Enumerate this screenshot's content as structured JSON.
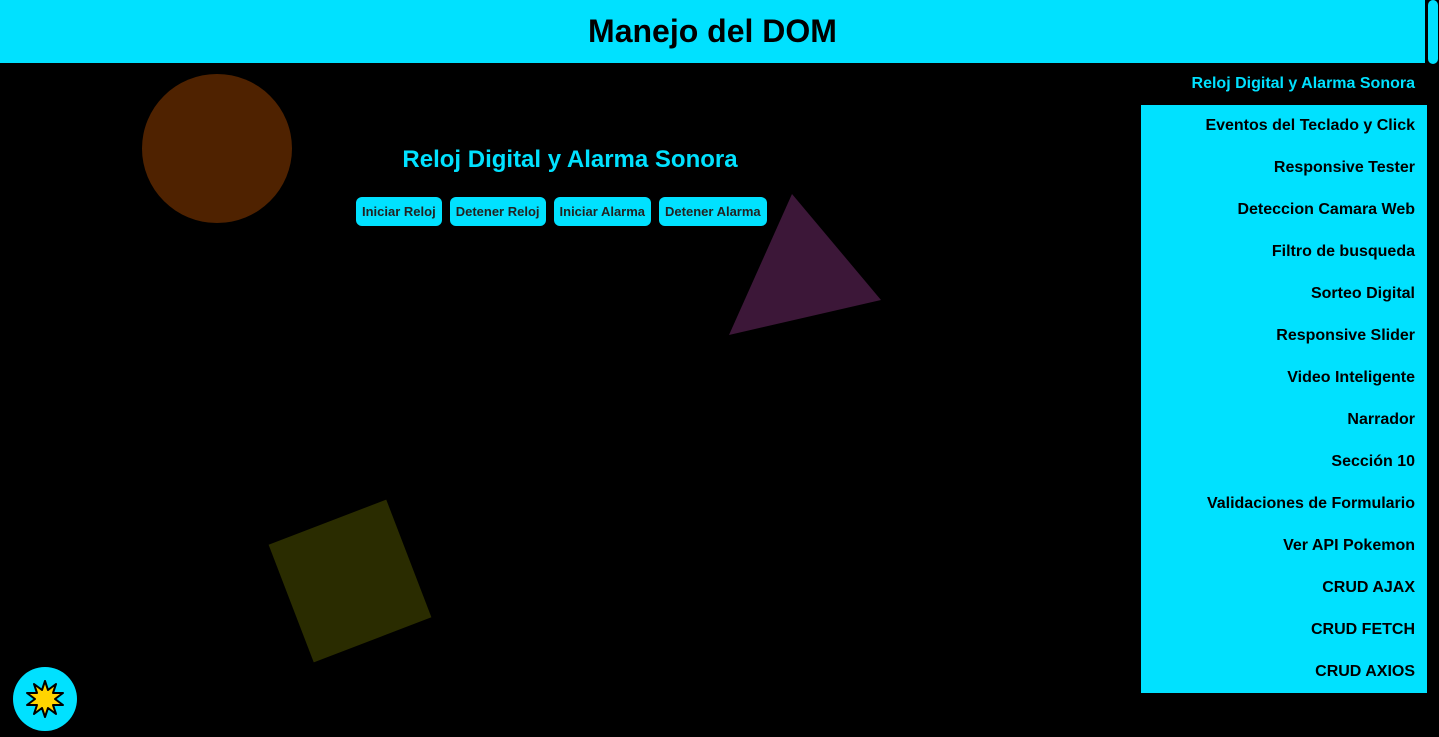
{
  "header": {
    "title": "Manejo del DOM"
  },
  "menu": {
    "items": [
      {
        "label": "Reloj Digital y Alarma Sonora"
      },
      {
        "label": "Eventos del Teclado y Click"
      },
      {
        "label": "Responsive Tester"
      },
      {
        "label": "Deteccion Camara Web"
      },
      {
        "label": "Filtro de busqueda"
      },
      {
        "label": "Sorteo Digital"
      },
      {
        "label": "Responsive Slider"
      },
      {
        "label": "Video Inteligente"
      },
      {
        "label": "Narrador"
      },
      {
        "label": "Sección 10"
      },
      {
        "label": "Validaciones de Formulario"
      },
      {
        "label": "Ver API Pokemon"
      },
      {
        "label": "CRUD AJAX"
      },
      {
        "label": "CRUD FETCH"
      },
      {
        "label": "CRUD AXIOS"
      }
    ]
  },
  "section": {
    "title": "Reloj Digital y Alarma Sonora",
    "buttons": {
      "start_clock": "Iniciar Reloj",
      "stop_clock": "Detener Reloj",
      "start_alarm": "Iniciar Alarma",
      "stop_alarm": "Detener Alarma"
    }
  },
  "theme_toggle": {
    "icon": "sun-icon"
  },
  "colors": {
    "accent": "#00e1ff",
    "background": "#000000",
    "circle": "#4f2200",
    "triangle": "#3c1738",
    "square": "#2a2c00",
    "sun": "#ffd400"
  }
}
